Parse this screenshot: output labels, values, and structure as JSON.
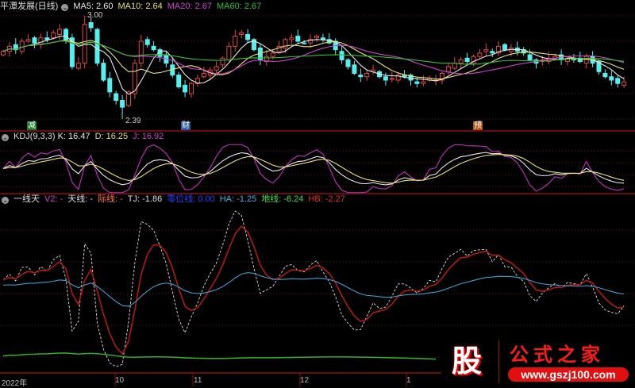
{
  "header": {
    "title": "平潭发展(日线)",
    "ma5": "MA5: 2.60",
    "ma10": "MA10: 2.64",
    "ma20": "MA20: 2.67",
    "ma60": "MA60: 2.67"
  },
  "kdj_header": {
    "name": "KDJ(9,3,3)",
    "k": "K: 16.47",
    "d": "D: 16.25",
    "j": "J: 16.92"
  },
  "ind_header": {
    "name": "一线天",
    "v2": "V2: -",
    "tian": "天线: -",
    "ji": "际线: -",
    "tj": "TJ: -1.86",
    "zero": "零位线: 0.00",
    "ha": "HA: -1.25",
    "di": "地线: -6.24",
    "hb": "HB: -2.27"
  },
  "markers": {
    "jian": "减",
    "cai": "财",
    "yu": "预"
  },
  "price_labels": {
    "high": "3.00",
    "low": "2.39"
  },
  "x_axis": [
    "2022年",
    "10",
    "11",
    "12",
    "1"
  ],
  "logo": {
    "glyph": "股",
    "name": "公式之家",
    "url": "www.gszj100.com"
  },
  "colors": {
    "up": "#e04646",
    "down": "#54f0f0",
    "ma5": "#e8e8e8",
    "ma10": "#e8e070",
    "ma20": "#d040d0",
    "ma60": "#30c030",
    "grid": "#7a1010"
  },
  "chart_data": {
    "type": "candlestick",
    "title": "平潭发展(日线)",
    "ylim": [
      2.3,
      3.05
    ],
    "closes": [
      2.79,
      2.82,
      2.8,
      2.85,
      2.86,
      2.84,
      2.87,
      2.86,
      2.9,
      2.92,
      2.86,
      2.7,
      2.72,
      2.95,
      2.93,
      2.72,
      2.62,
      2.55,
      2.5,
      2.46,
      2.55,
      2.72,
      2.85,
      2.83,
      2.8,
      2.76,
      2.72,
      2.65,
      2.58,
      2.55,
      2.6,
      2.63,
      2.66,
      2.68,
      2.7,
      2.75,
      2.82,
      2.88,
      2.9,
      2.86,
      2.8,
      2.74,
      2.76,
      2.78,
      2.82,
      2.86,
      2.87,
      2.85,
      2.84,
      2.86,
      2.88,
      2.86,
      2.84,
      2.8,
      2.74,
      2.7,
      2.66,
      2.64,
      2.66,
      2.68,
      2.64,
      2.62,
      2.63,
      2.65,
      2.64,
      2.62,
      2.6,
      2.61,
      2.63,
      2.62,
      2.66,
      2.7,
      2.72,
      2.74,
      2.73,
      2.76,
      2.78,
      2.8,
      2.78,
      2.82,
      2.8,
      2.81,
      2.79,
      2.78,
      2.74,
      2.72,
      2.74,
      2.75,
      2.76,
      2.74,
      2.75,
      2.74,
      2.73,
      2.76,
      2.72,
      2.67,
      2.64,
      2.62,
      2.6,
      2.61
    ],
    "high": 3.0,
    "low": 2.39,
    "ma_periods": [
      5,
      10,
      20,
      60
    ]
  }
}
